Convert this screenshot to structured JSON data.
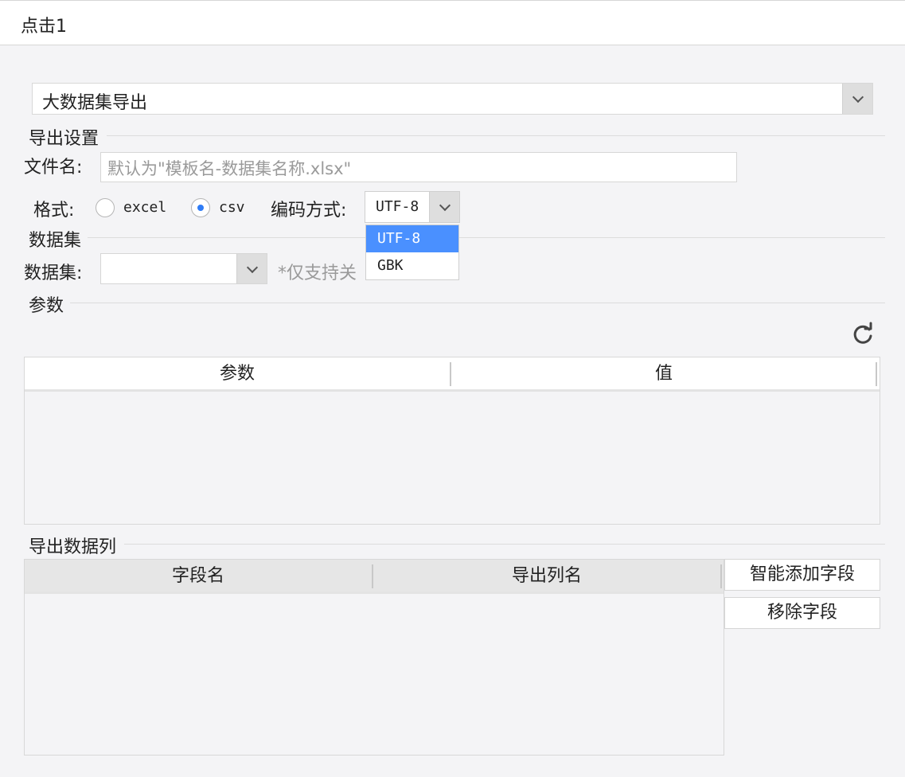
{
  "title": "点击1",
  "export_type": {
    "selected": "大数据集导出"
  },
  "export_settings": {
    "section_title": "导出设置",
    "filename_label": "文件名:",
    "filename_placeholder": "默认为\"模板名-数据集名称.xlsx\"",
    "format_label": "格式:",
    "format_options": [
      {
        "label": "excel",
        "checked": false
      },
      {
        "label": "csv",
        "checked": true
      }
    ],
    "encoding_label": "编码方式:",
    "encoding_value": "UTF-8",
    "encoding_options": [
      "UTF-8",
      "GBK"
    ]
  },
  "dataset": {
    "section_title": "数据集",
    "label": "数据集:",
    "note": "*仅支持关"
  },
  "params": {
    "section_title": "参数",
    "columns": [
      "参数",
      "值"
    ],
    "refresh_icon": "refresh-icon"
  },
  "export_columns": {
    "section_title": "导出数据列",
    "columns": [
      "字段名",
      "导出列名"
    ],
    "smart_add_button": "智能添加字段",
    "remove_button": "移除字段"
  },
  "colors": {
    "accent": "#4a90ff",
    "radio_checked": "#2f7cf6"
  }
}
